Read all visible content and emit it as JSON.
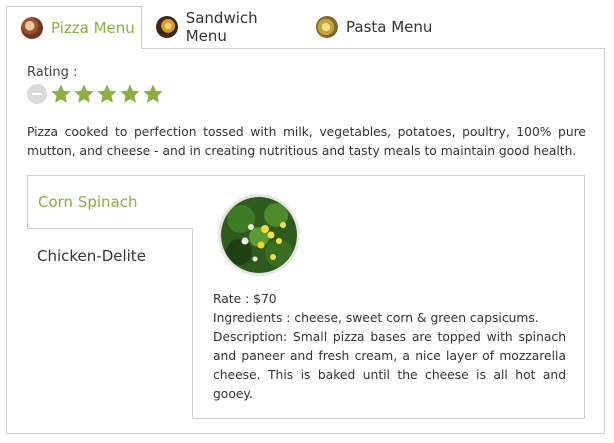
{
  "tabs": [
    {
      "label": "Pizza Menu",
      "icon": "pizza-icon",
      "active": true
    },
    {
      "label": "Sandwich Menu",
      "icon": "sandwich-icon",
      "active": false
    },
    {
      "label": "Pasta Menu",
      "icon": "pasta-icon",
      "active": false
    }
  ],
  "rating": {
    "label": "Rating :",
    "value": 5,
    "max": 5,
    "star_color": "#8cb03f",
    "reset_icon": "minus-circle-icon"
  },
  "intro": "Pizza cooked to perfection tossed with milk, vegetables, potatoes, poultry, 100% pure mutton, and cheese - and in creating nutritious and tasty meals to maintain good health.",
  "items": [
    {
      "label": "Corn Spinach",
      "active": true
    },
    {
      "label": "Chicken-Delite",
      "active": false
    }
  ],
  "detail": {
    "photo_icon": "corn-spinach-pizza-photo",
    "rate": "Rate : $70",
    "ingredients": "Ingredients : cheese, sweet corn & green capsicums.",
    "description": "Description: Small pizza bases are topped with spinach and paneer and fresh cream, a nice layer of mozzarella cheese. This is baked until the cheese is all hot and gooey."
  },
  "colors": {
    "accent": "#8cb03f",
    "border": "#cfcfcf",
    "text": "#333333"
  }
}
